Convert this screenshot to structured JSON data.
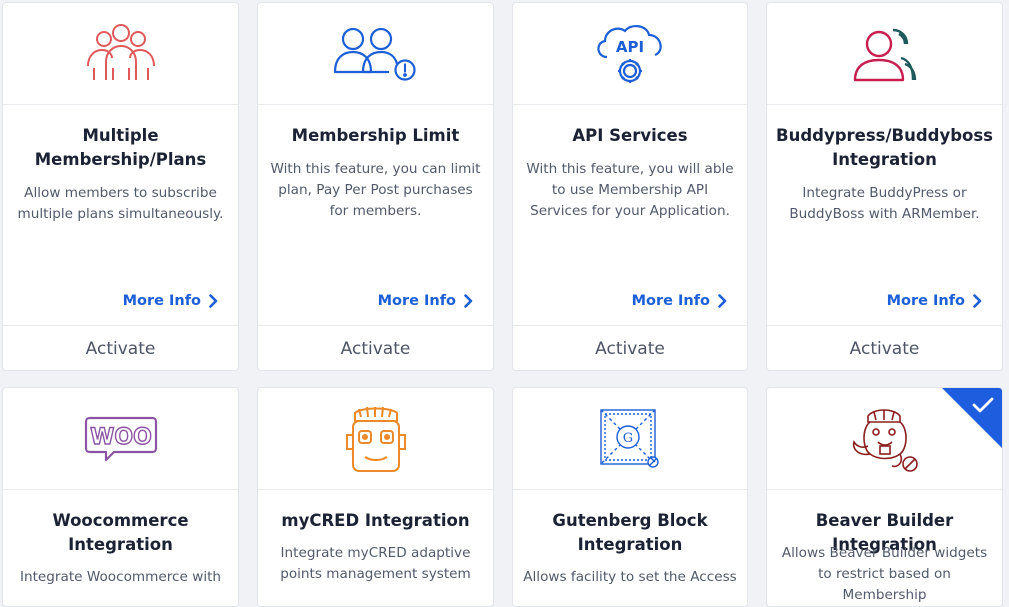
{
  "colors": {
    "accent": "#1c5fd6",
    "icon_red": "#e05a5a",
    "icon_blue": "#1c5fd6",
    "icon_crimson": "#c81d4f",
    "icon_teal": "#1e5a5c",
    "icon_woo": "#8b55a3",
    "icon_orange": "#ec8a2a",
    "icon_beaver": "#8a1e1e",
    "badge_blue": "#1e5ede"
  },
  "cards": [
    {
      "title": "Multiple Membership/Plans",
      "description": "Allow members to subscribe multiple plans simultaneously.",
      "icon": "group-of-people-icon",
      "more_info": "More Info",
      "action": "Activate"
    },
    {
      "title": "Membership Limit",
      "description": "With this feature, you can limit plan, Pay Per Post purchases for members.",
      "icon": "users-with-alert-icon",
      "more_info": "More Info",
      "action": "Activate"
    },
    {
      "title": "API Services",
      "description": "With this feature, you will able to use Membership API Services for your Application.",
      "icon": "api-cloud-gear-icon",
      "more_info": "More Info",
      "action": "Activate"
    },
    {
      "title": "Buddypress/Buddyboss Integration",
      "description": "Integrate BuddyPress or BuddyBoss with ARMember.",
      "icon": "buddypress-users-icon",
      "more_info": "More Info",
      "action": "Activate"
    },
    {
      "title": "Woocommerce Integration",
      "description": "Integrate Woocommerce with",
      "icon": "woocommerce-logo-icon",
      "logo_text": "WOO"
    },
    {
      "title": "myCRED Integration",
      "description": "Integrate myCRED adaptive points management system",
      "icon": "mycred-mascot-icon"
    },
    {
      "title": "Gutenberg Block Integration",
      "description": "Allows facility to set the Access",
      "icon": "gutenberg-logo-icon",
      "logo_text": "G"
    },
    {
      "title": "Beaver Builder Integration",
      "description": "Allows Beaver Builder widgets to restrict based on Membership",
      "icon": "beaver-mascot-icon",
      "active": true
    }
  ]
}
